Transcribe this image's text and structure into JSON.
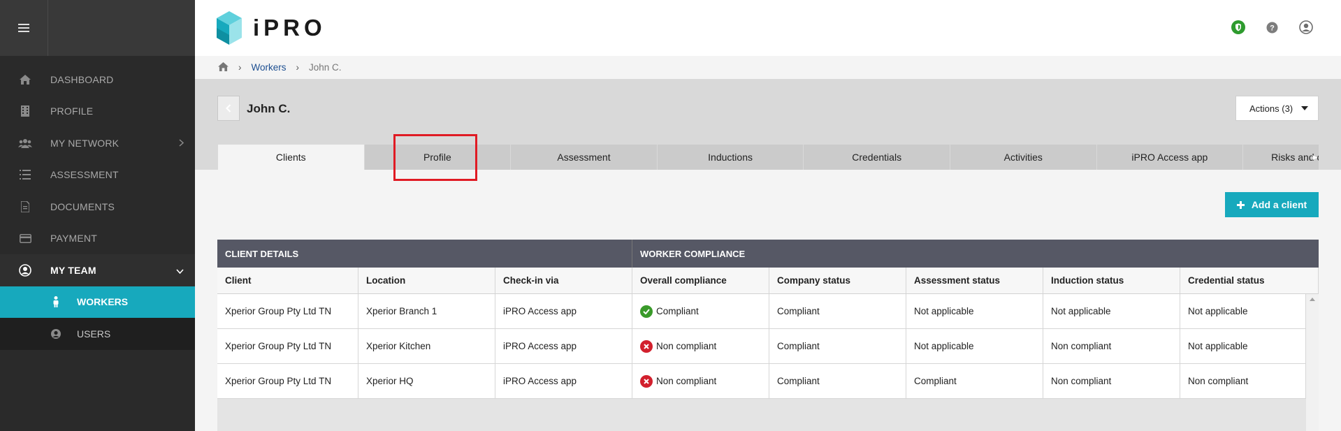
{
  "sidebar": {
    "items": [
      {
        "label": "DASHBOARD"
      },
      {
        "label": "PROFILE"
      },
      {
        "label": "MY NETWORK"
      },
      {
        "label": "ASSESSMENT"
      },
      {
        "label": "DOCUMENTS"
      },
      {
        "label": "PAYMENT"
      },
      {
        "label": "MY TEAM"
      }
    ],
    "subitems": [
      {
        "label": "WORKERS"
      },
      {
        "label": "USERS"
      }
    ]
  },
  "header": {
    "logo_text": "iPRO"
  },
  "breadcrumb": {
    "workers": "Workers",
    "current": "John C."
  },
  "page": {
    "title": "John C.",
    "actions_label": "Actions (3)"
  },
  "tabs": [
    {
      "label": "Clients"
    },
    {
      "label": "Profile"
    },
    {
      "label": "Assessment"
    },
    {
      "label": "Inductions"
    },
    {
      "label": "Credentials"
    },
    {
      "label": "Activities"
    },
    {
      "label": "iPRO Access app"
    },
    {
      "label": "Risks and c"
    }
  ],
  "add_client_label": "Add a client",
  "table": {
    "group_headers": [
      "CLIENT DETAILS",
      "WORKER COMPLIANCE"
    ],
    "columns": [
      "Client",
      "Location",
      "Check-in via",
      "Overall compliance",
      "Company status",
      "Assessment status",
      "Induction status",
      "Credential status"
    ],
    "rows": [
      [
        "Xperior Group Pty Ltd TN",
        "Xperior Branch 1",
        "iPRO Access app",
        "Compliant",
        "Compliant",
        "Not applicable",
        "Not applicable",
        "Not applicable"
      ],
      [
        "Xperior Group Pty Ltd TN",
        "Xperior Kitchen",
        "iPRO Access app",
        "Non compliant",
        "Compliant",
        "Not applicable",
        "Non compliant",
        "Not applicable"
      ],
      [
        "Xperior Group Pty Ltd TN",
        "Xperior HQ",
        "iPRO Access app",
        "Non compliant",
        "Compliant",
        "Compliant",
        "Non compliant",
        "Non compliant"
      ]
    ]
  },
  "colors": {
    "accent": "#17a9bd",
    "compliant": "#3a9a2a",
    "non_compliant": "#d2202d",
    "highlight": "#e01b24"
  }
}
